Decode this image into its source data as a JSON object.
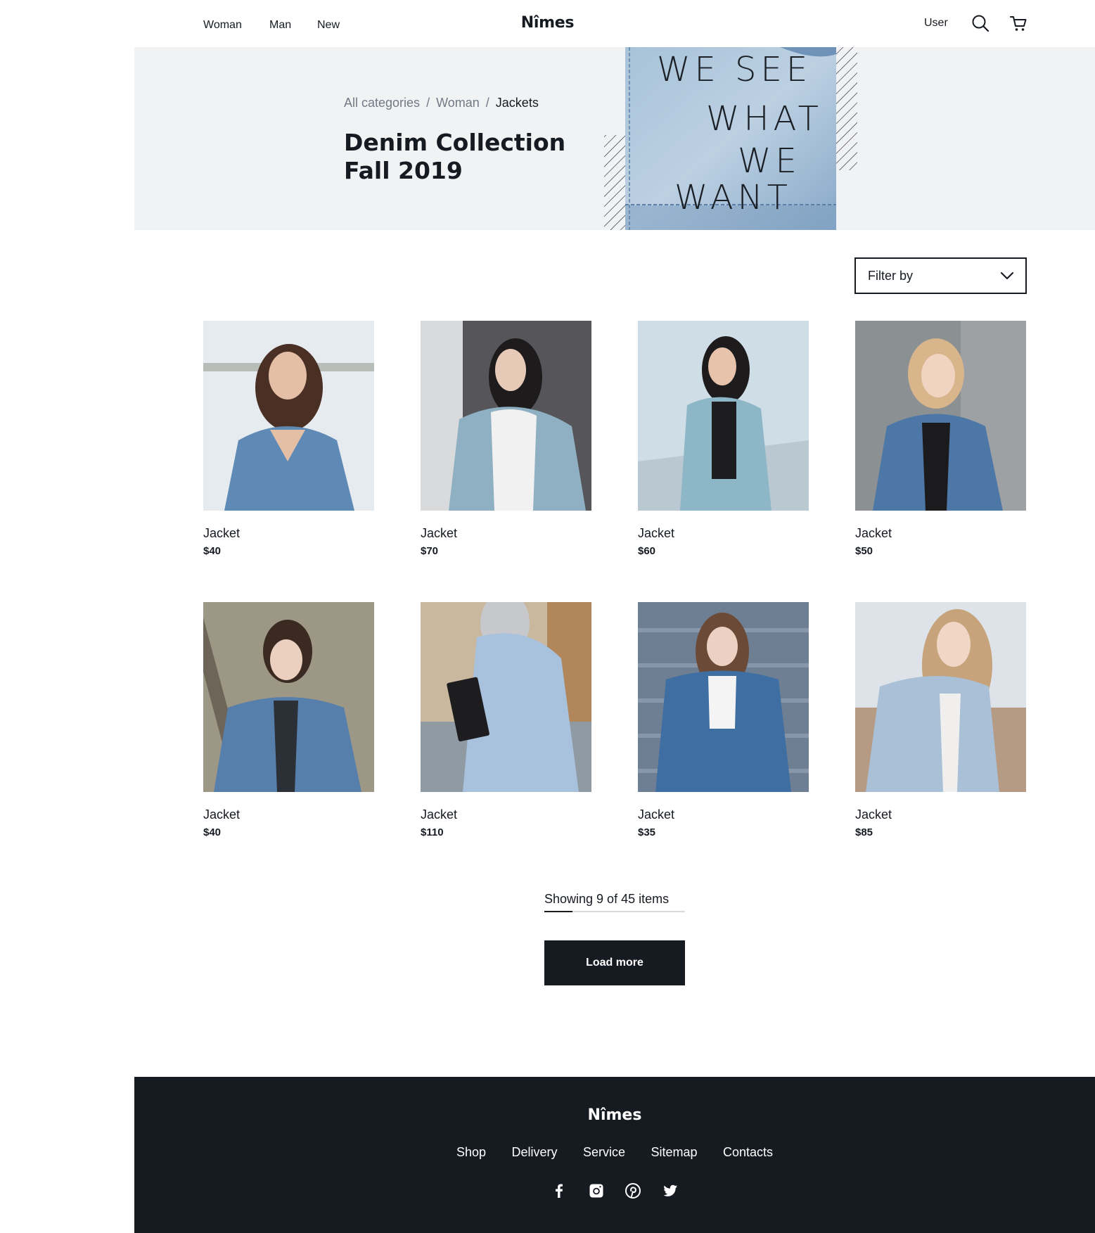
{
  "header": {
    "nav": [
      {
        "label": "Woman"
      },
      {
        "label": "Man"
      },
      {
        "label": "New"
      }
    ],
    "logo": "Nîmes",
    "user_label": "User"
  },
  "hero": {
    "breadcrumb": [
      "All categories",
      "Woman",
      "Jackets"
    ],
    "title_line1": "Denim Collection",
    "title_line2": "Fall 2019",
    "image_text": [
      "WE SEE",
      "WHAT",
      "WE",
      "WANT"
    ]
  },
  "filter": {
    "label": "Filter by"
  },
  "products": [
    {
      "name": "Jacket",
      "price": "$40"
    },
    {
      "name": "Jacket",
      "price": "$70"
    },
    {
      "name": "Jacket",
      "price": "$60"
    },
    {
      "name": "Jacket",
      "price": "$50"
    },
    {
      "name": "Jacket",
      "price": "$40"
    },
    {
      "name": "Jacket",
      "price": "$110"
    },
    {
      "name": "Jacket",
      "price": "$35"
    },
    {
      "name": "Jacket",
      "price": "$85"
    }
  ],
  "pagination": {
    "showing_text": "Showing 9 of 45 items",
    "shown": 9,
    "total": 45,
    "load_more_label": "Load more"
  },
  "footer": {
    "logo": "Nîmes",
    "links": [
      "Shop",
      "Delivery",
      "Service",
      "Sitemap",
      "Contacts"
    ],
    "socials": [
      "facebook-icon",
      "instagram-icon",
      "pinterest-icon",
      "twitter-icon"
    ]
  },
  "colors": {
    "ink": "#161a21",
    "hero_bg": "#f1f2f4",
    "muted": "#707985",
    "denim_light": "#a9c3d9",
    "denim_mid": "#6b93bb",
    "denim_dark": "#3f6a97"
  }
}
